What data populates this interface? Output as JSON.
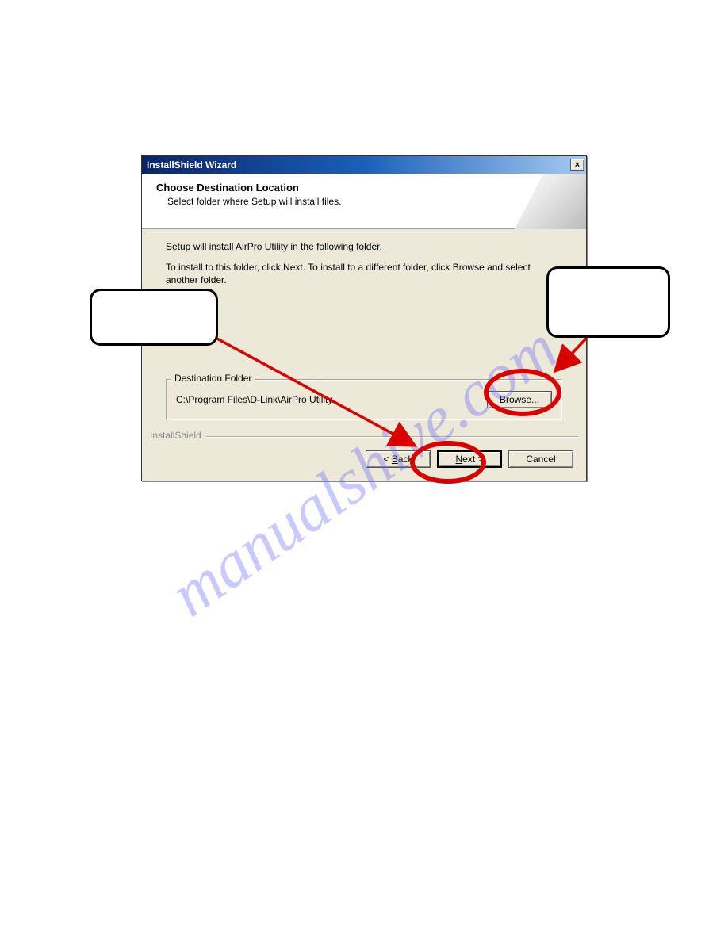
{
  "watermark": "manualshive.com",
  "dialog": {
    "title": "InstallShield Wizard",
    "close_label": "×",
    "header_title": "Choose Destination Location",
    "header_sub": "Select folder where Setup will install files.",
    "body_line1": "Setup will install AirPro Utility in the following folder.",
    "body_line2": "To install to this folder, click Next. To install to a different folder, click Browse and select another folder.",
    "dest_group_label": "Destination Folder",
    "dest_path": "C:\\Program Files\\D-Link\\AirPro Utility",
    "browse_label_pre": "B",
    "browse_label_mid": "r",
    "browse_label_post": "owse...",
    "footer_brand": "InstallShield",
    "back_pre": "< ",
    "back_u": "B",
    "back_post": "ack",
    "next_u": "N",
    "next_post": "ext >",
    "cancel_label": "Cancel"
  }
}
